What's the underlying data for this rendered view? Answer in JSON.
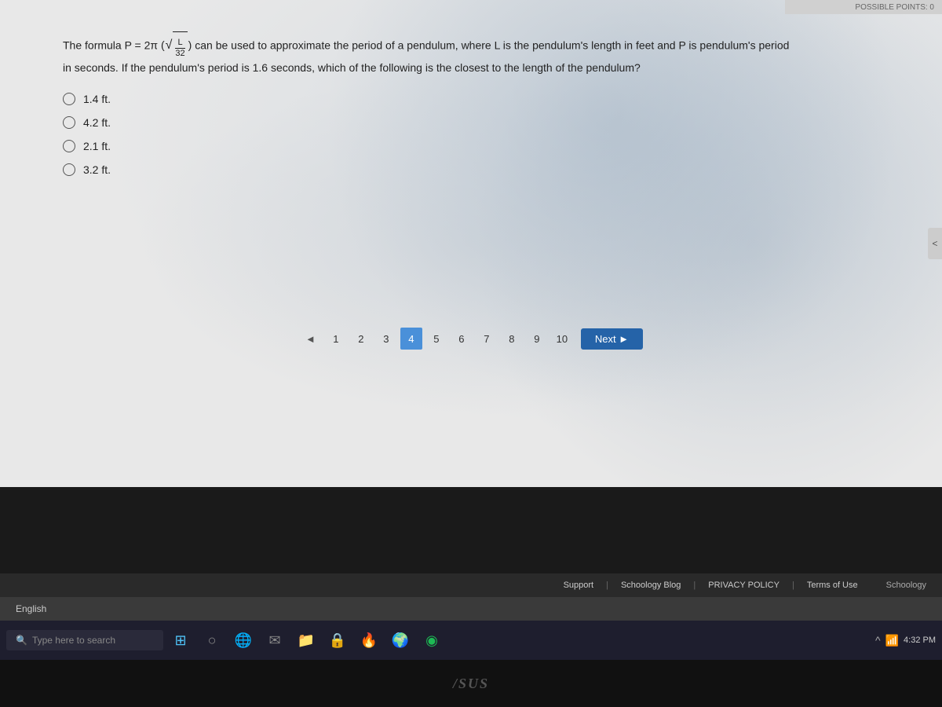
{
  "header": {
    "partial_text": "POSSIBLE POINTS: 0"
  },
  "question": {
    "formula_prefix": "The formula P = 2π",
    "formula_fraction_num": "L",
    "formula_fraction_den": "32",
    "formula_suffix": "can be used to approximate the period of a pendulum, where L is the pendulum's length in feet and P is pendulum's period",
    "line2": "in seconds. If the pendulum's period is 1.6 seconds, which of the following is the closest to the length of the pendulum?"
  },
  "choices": [
    {
      "id": "a",
      "text": "1.4 ft."
    },
    {
      "id": "b",
      "text": "4.2 ft."
    },
    {
      "id": "c",
      "text": "2.1 ft."
    },
    {
      "id": "d",
      "text": "3.2 ft."
    }
  ],
  "pagination": {
    "prev_label": "◄",
    "pages": [
      "1",
      "2",
      "3",
      "4",
      "5",
      "6",
      "7",
      "8",
      "9",
      "10"
    ],
    "active_page": "4",
    "next_label": "Next ►"
  },
  "footer": {
    "support": "Support",
    "sep1": "|",
    "blog": "Schoology Blog",
    "sep2": "|",
    "privacy": "PRIVACY POLICY",
    "sep3": "|",
    "terms": "Terms of Use",
    "logo": "Schoology"
  },
  "language": {
    "label": "English"
  },
  "taskbar": {
    "search_placeholder": "Type here to search",
    "search_icon": "🔍"
  },
  "asus": {
    "logo": "/SUS"
  },
  "collapse_arrow": "<"
}
